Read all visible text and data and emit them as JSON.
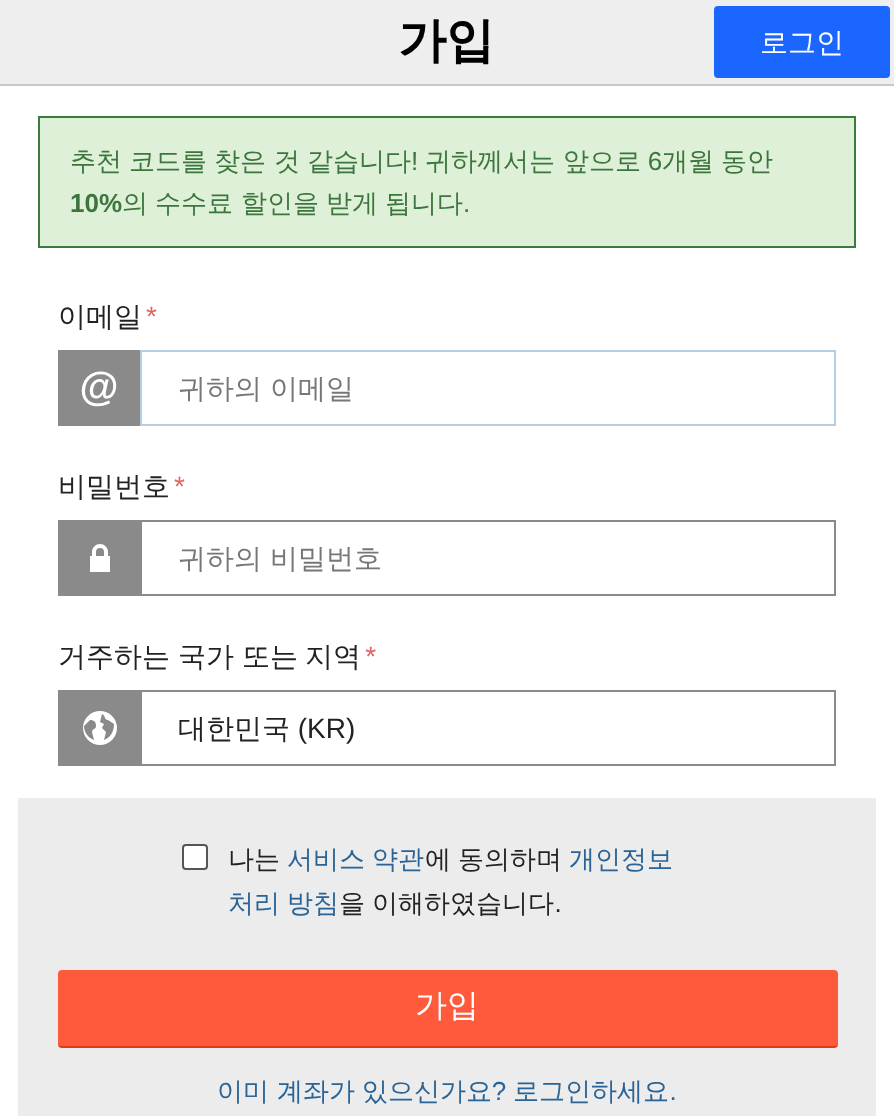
{
  "header": {
    "title": "가입",
    "login_button": "로그인"
  },
  "notice": "추천 코드를 찾은 것 같습니다! 귀하께서는 앞으로 6개월 동안 **10%**의 수수료 할인을 받게 됩니다.",
  "fields": [
    {
      "label": "이메일",
      "required": "*",
      "icon_char": "@",
      "placeholder": "귀하의 이메일",
      "focused": true
    },
    {
      "label": "비밀번호",
      "required": "*",
      "placeholder": "귀하의 비밀번호",
      "focused": false
    },
    {
      "label": "거주하는 국가 또는 지역",
      "required": "*",
      "value": "대한민국 (KR)",
      "focused": false
    }
  ],
  "agreement": {
    "checked": false,
    "parts": [
      {
        "text": "나는 ",
        "kind": "text"
      },
      {
        "text": "서비스 약관",
        "kind": "link"
      },
      {
        "text": "에 동의하며 ",
        "kind": "text"
      },
      {
        "text": "개인정보",
        "kind": "link"
      },
      {
        "text": "처리 방침",
        "kind": "link"
      },
      {
        "text": "을 이해하였습니다.",
        "kind": "text"
      }
    ]
  },
  "signup_button": "가입",
  "login_link": "이미 계좌가 있으신가요? 로그인하세요."
}
